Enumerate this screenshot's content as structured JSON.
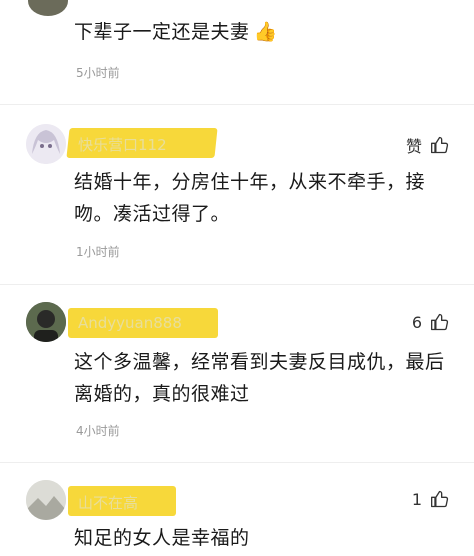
{
  "comments": [
    {
      "user": "",
      "text": "下辈子一定还是夫妻",
      "emoji": "👍",
      "time": "5小时前",
      "like_label": ""
    },
    {
      "user": "快乐营口112",
      "text_line1": "结婚十年，分房住十年，从来不牵手，接",
      "text_line2": "吻。凑活过得了。",
      "time": "1小时前",
      "like_label": "赞"
    },
    {
      "user": "Andyyuan888",
      "text_line1": "这个多温馨，经常看到夫妻反目成仇，最后",
      "text_line2": "离婚的，真的很难过",
      "time": "4小时前",
      "like_label": "6"
    },
    {
      "user": "山不在高",
      "text": "知足的女人是幸福的",
      "time": "",
      "like_label": "1"
    }
  ],
  "colors": {
    "highlight": "#f7d83a",
    "muted": "#9a9a9a"
  },
  "icons": {
    "like": "thumbs-up-icon"
  }
}
